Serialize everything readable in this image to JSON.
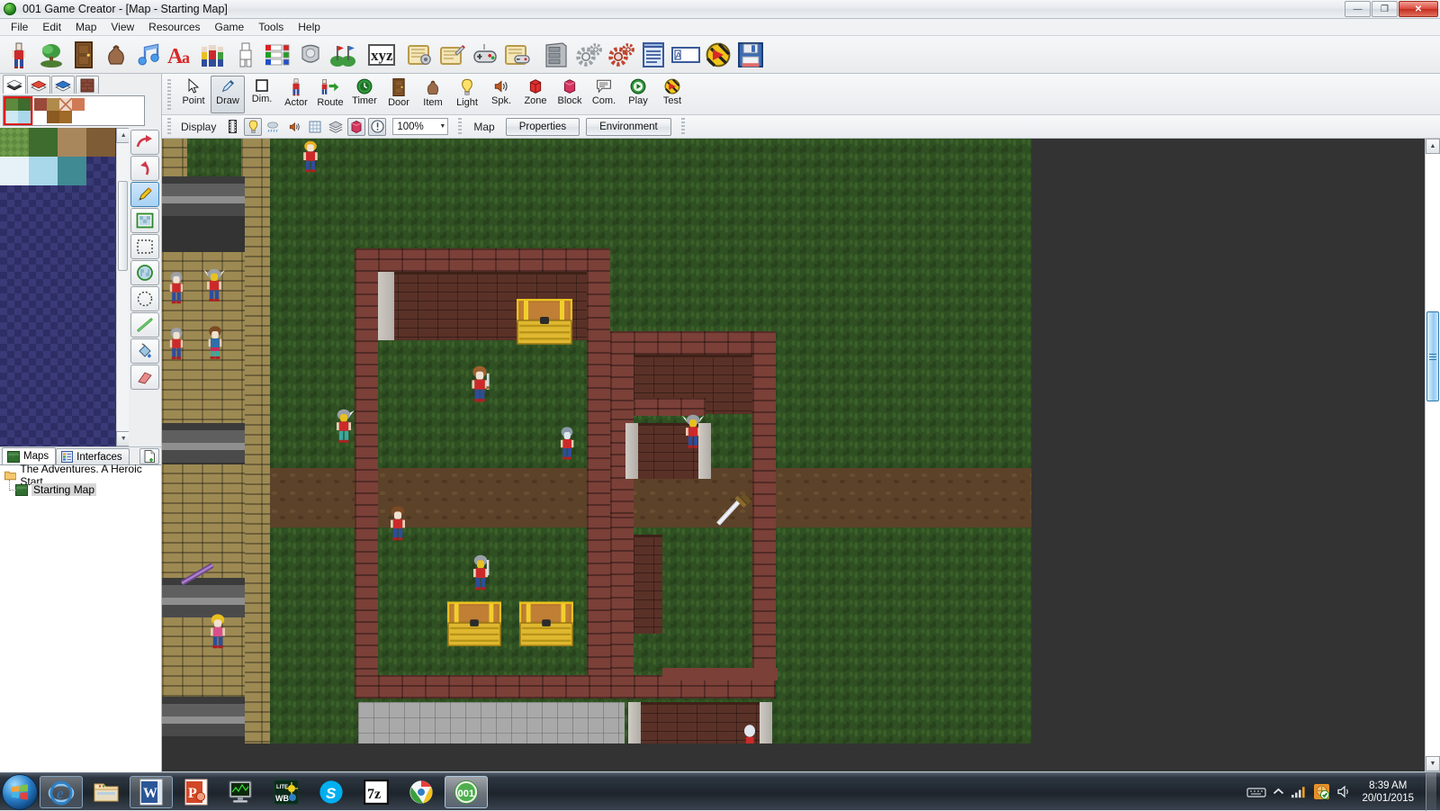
{
  "window": {
    "title": "001 Game Creator - [Map - Starting Map]",
    "app_icon": "game-creator-orb-icon",
    "minimize_label": "—",
    "restore_label": "❐",
    "close_label": "✕"
  },
  "menu": {
    "items": [
      {
        "label": "File"
      },
      {
        "label": "Edit"
      },
      {
        "label": "Map"
      },
      {
        "label": "View"
      },
      {
        "label": "Resources"
      },
      {
        "label": "Game"
      },
      {
        "label": "Tools"
      },
      {
        "label": "Help"
      }
    ]
  },
  "main_toolbar": {
    "buttons": [
      {
        "icon": "actor-icon",
        "tooltip": "Actors"
      },
      {
        "icon": "tree-object-icon",
        "tooltip": "Objects"
      },
      {
        "icon": "door-icon",
        "tooltip": "Doors"
      },
      {
        "icon": "item-bag-icon",
        "tooltip": "Items"
      },
      {
        "icon": "music-note-icon",
        "tooltip": "Music"
      },
      {
        "icon": "font-aa-icon",
        "tooltip": "Fonts"
      },
      {
        "icon": "party-group-icon",
        "tooltip": "Party"
      },
      {
        "icon": "character-template-icon",
        "tooltip": "Character Templates"
      },
      {
        "icon": "status-bars-icon",
        "tooltip": "Interfaces"
      },
      {
        "icon": "armor-icon",
        "tooltip": "Equipment"
      },
      {
        "icon": "teams-flags-icon",
        "tooltip": "Teams"
      },
      {
        "icon": "xyz-variables-icon",
        "tooltip": "Variables"
      },
      {
        "icon": "script-gear-icon",
        "tooltip": "Scripts"
      },
      {
        "icon": "script-edit-icon",
        "tooltip": "Edit Script"
      },
      {
        "icon": "gamepad-icon",
        "tooltip": "Input"
      },
      {
        "icon": "script-gamepad-icon",
        "tooltip": "Input Scripts"
      },
      {
        "icon": "database-cabinet-icon",
        "tooltip": "Database"
      },
      {
        "icon": "gears-gray-icon",
        "tooltip": "Settings"
      },
      {
        "icon": "gears-red-icon",
        "tooltip": "Game Settings"
      },
      {
        "icon": "list-document-icon",
        "tooltip": "Lists"
      },
      {
        "icon": "text-field-icon",
        "tooltip": "Text"
      },
      {
        "icon": "hazard-ball-icon",
        "tooltip": "Debug"
      },
      {
        "icon": "save-floppy-icon",
        "tooltip": "Save"
      }
    ]
  },
  "tool_palette": {
    "tools": [
      {
        "label": "Point",
        "icon": "cursor-arrow-icon",
        "active": false
      },
      {
        "label": "Draw",
        "icon": "pencil-icon",
        "active": true
      },
      {
        "label": "Dim.",
        "icon": "square-outline-icon",
        "active": false
      },
      {
        "label": "Actor",
        "icon": "actor-icon",
        "active": false
      },
      {
        "label": "Route",
        "icon": "route-arrow-icon",
        "active": false
      },
      {
        "label": "Timer",
        "icon": "timer-icon",
        "active": false
      },
      {
        "label": "Door",
        "icon": "door-icon",
        "active": false
      },
      {
        "label": "Item",
        "icon": "item-bag-icon",
        "active": false
      },
      {
        "label": "Light",
        "icon": "lightbulb-icon",
        "active": false
      },
      {
        "label": "Spk.",
        "icon": "speaker-icon",
        "active": false
      },
      {
        "label": "Zone",
        "icon": "zone-cube-icon",
        "active": false
      },
      {
        "label": "Block",
        "icon": "block-cube-icon",
        "active": false
      },
      {
        "label": "Com.",
        "icon": "comment-icon",
        "active": false
      },
      {
        "label": "Play",
        "icon": "play-green-icon",
        "active": false
      },
      {
        "label": "Test",
        "icon": "test-hazard-icon",
        "active": false
      }
    ]
  },
  "display_bar": {
    "label": "Display",
    "toggles": [
      {
        "icon": "film-strip-icon",
        "on": false
      },
      {
        "icon": "lightbulb-icon",
        "on": true
      },
      {
        "icon": "weather-rain-icon",
        "on": false
      },
      {
        "icon": "speaker-icon",
        "on": false
      },
      {
        "icon": "grid-icon",
        "on": false
      },
      {
        "icon": "layers-icon",
        "on": false
      },
      {
        "icon": "block-cube-icon",
        "on": true
      },
      {
        "icon": "info-circle-icon",
        "on": true
      }
    ],
    "zoom": "100%",
    "zoom_arrow": "▼",
    "map_label": "Map",
    "properties_button": "Properties",
    "environment_button": "Environment"
  },
  "tileset_panel": {
    "layer_tabs": [
      {
        "icon": "layer-ground-icon",
        "active": true
      },
      {
        "icon": "layer-mid-icon",
        "active": false
      },
      {
        "icon": "layer-top-icon",
        "active": false
      },
      {
        "icon": "layer-wall-icon",
        "active": false
      }
    ],
    "selection_scroll_up": "▲",
    "selection_scroll_down": "▼",
    "draw_tools": [
      {
        "icon": "redo-arrow-icon",
        "active": false
      },
      {
        "icon": "undo-arrow-icon",
        "active": false
      },
      {
        "icon": "pencil-icon",
        "active": true
      },
      {
        "icon": "filled-rect-icon",
        "active": false
      },
      {
        "icon": "select-rect-icon",
        "active": false
      },
      {
        "icon": "filled-ellipse-icon",
        "active": false
      },
      {
        "icon": "ellipse-icon",
        "active": false
      },
      {
        "icon": "line-icon",
        "active": false
      },
      {
        "icon": "paint-bucket-icon",
        "active": false
      },
      {
        "icon": "eraser-icon",
        "active": false
      }
    ]
  },
  "project_tree": {
    "tabs": [
      {
        "label": "Maps",
        "icon": "maps-icon",
        "active": true
      },
      {
        "label": "Interfaces",
        "icon": "interfaces-icon",
        "active": false
      }
    ],
    "new_button_icon": "new-document-icon",
    "root": {
      "label": "The Adventures. A Heroic Start",
      "icon": "folder-icon"
    },
    "children": [
      {
        "label": "Starting Map",
        "icon": "map-icon",
        "selected": true
      }
    ]
  },
  "canvas": {
    "background_color": "#333333",
    "grass_color": "#2f5022",
    "brick_color": "#7b4038",
    "dirt_color": "#5c4228",
    "path_color": "#9d8a53",
    "scroll_up": "▲",
    "scroll_down": "▼",
    "scroll_left": "◀",
    "scroll_right": "▶",
    "hthumb_grip": "|||"
  },
  "taskbar": {
    "start_icon": "windows-start-orb-icon",
    "tasks": [
      {
        "icon": "internet-explorer-icon",
        "state": "pinned"
      },
      {
        "icon": "windows-explorer-icon",
        "state": "normal"
      },
      {
        "icon": "word-icon",
        "state": "pinned"
      },
      {
        "icon": "powerpoint-icon",
        "state": "normal"
      },
      {
        "icon": "monitor-app-icon",
        "state": "normal"
      },
      {
        "icon": "litecweb-icon",
        "state": "normal"
      },
      {
        "icon": "skype-icon",
        "state": "normal"
      },
      {
        "icon": "sevenzip-icon",
        "state": "normal"
      },
      {
        "icon": "chrome-icon",
        "state": "normal"
      },
      {
        "icon": "game-creator-001-icon",
        "state": "active"
      }
    ],
    "tray": [
      {
        "icon": "keyboard-icon"
      },
      {
        "icon": "show-hidden-chevron-icon"
      },
      {
        "icon": "network-signal-icon"
      },
      {
        "icon": "security-shield-icon"
      },
      {
        "icon": "volume-icon"
      }
    ],
    "clock_time": "8:39 AM",
    "clock_date": "20/01/2015"
  }
}
